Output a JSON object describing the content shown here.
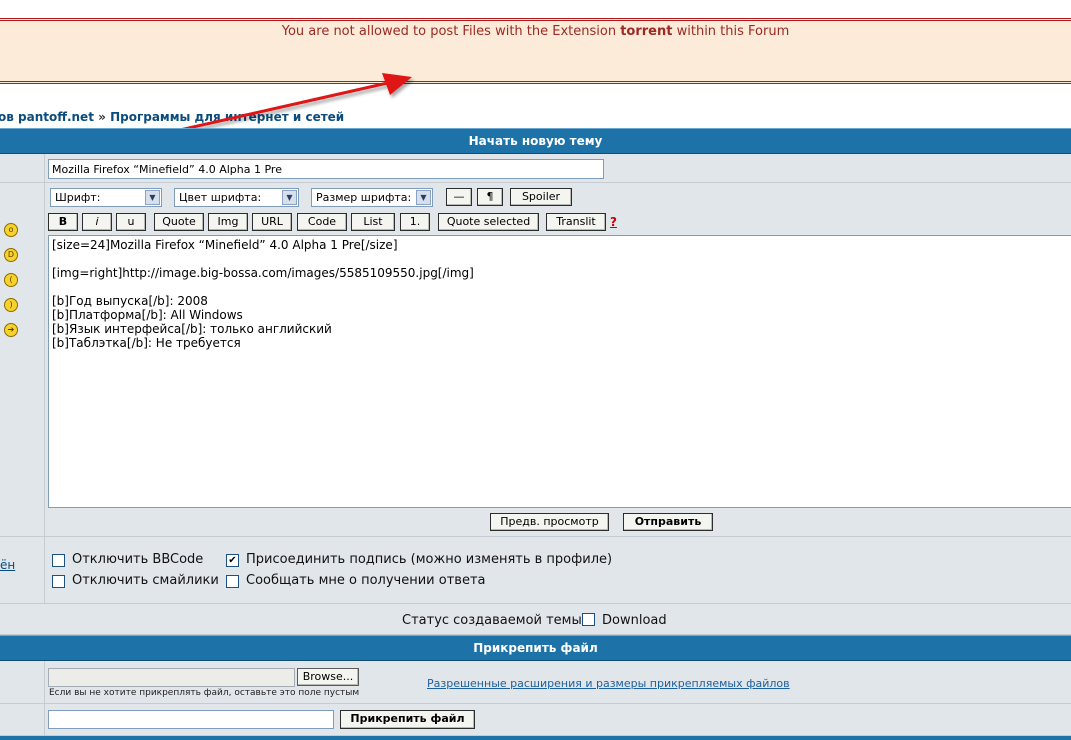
{
  "banner": {
    "text_before": "You are not allowed to post Files with the Extension ",
    "extension": "torrent",
    "text_after": " within this Forum"
  },
  "breadcrumb": {
    "forum": "ов pantoff.net",
    "separator": "»",
    "section": "Программы для интернет и сетей"
  },
  "new_topic": {
    "header": "Начать новую тему",
    "subject_value": "Mozilla Firefox “Minefield” 4.0 Alpha 1 Pre"
  },
  "toolbar": {
    "font_select": "Шрифт:",
    "color_select": "Цвет шрифта:",
    "size_select": "Размер шрифта:",
    "hr_button": "—",
    "para_button": "¶",
    "spoiler_button": "Spoiler",
    "bold_button": "B",
    "italic_button": "i",
    "underline_button": "u",
    "quote_button": "Quote",
    "img_button": "Img",
    "url_button": "URL",
    "code_button": "Code",
    "list_button": "List",
    "list_num_button": "1.",
    "quote_selected_button": "Quote selected",
    "translit_button": "Translit",
    "help_link": "?"
  },
  "editor": {
    "content": "[size=24]Mozilla Firefox “Minefield” 4.0 Alpha 1 Pre[/size]\n\n[img=right]http://image.big-bossa.com/images/5585109550.jpg[/img]\n\n[b]Год выпуска[/b]: 2008\n[b]Платформа[/b]: All Windows\n[b]Язык интерфейса[/b]: только английский\n[b]Таблэтка[/b]: Не требуется"
  },
  "actions": {
    "preview_button": "Предв. просмотр",
    "submit_button": "Отправить"
  },
  "options": {
    "left_link": "ён",
    "disable_bbcode": "Отключить BBCode",
    "disable_smilies": "Отключить смайлики",
    "attach_signature": "Присоединить подпись (можно изменять в профиле)",
    "notify_reply": "Сообщать мне о получении ответа",
    "disable_bbcode_checked": false,
    "disable_smilies_checked": false,
    "attach_signature_checked": true,
    "notify_reply_checked": false
  },
  "status": {
    "label": "Статус создаваемой темы:",
    "download_label": "Download",
    "download_checked": false
  },
  "attach": {
    "header": "Прикрепить файл",
    "browse_button": "Browse...",
    "hint": "Если вы не хотите прикреплять файл, оставьте это поле пустым",
    "allowed_link": "Разрешенные расширения и размеры прикрепляемых файлов",
    "comment_value": "",
    "attach_button": "Прикрепить файл"
  },
  "colors": {
    "header_blue": "#1d72a8",
    "banner_bg": "#fbebd8",
    "banner_text": "#9c2a24",
    "arrow_red": "#e01515",
    "row_bg": "#e1e6ea",
    "link_blue": "#0b4c7d"
  },
  "icons": [
    "smiley-surprised-icon",
    "smiley-laugh-icon",
    "smiley-sad-icon",
    "smiley-smile-icon",
    "smiley-arrow-icon",
    "select-arrow-icon",
    "checkmark-icon"
  ]
}
